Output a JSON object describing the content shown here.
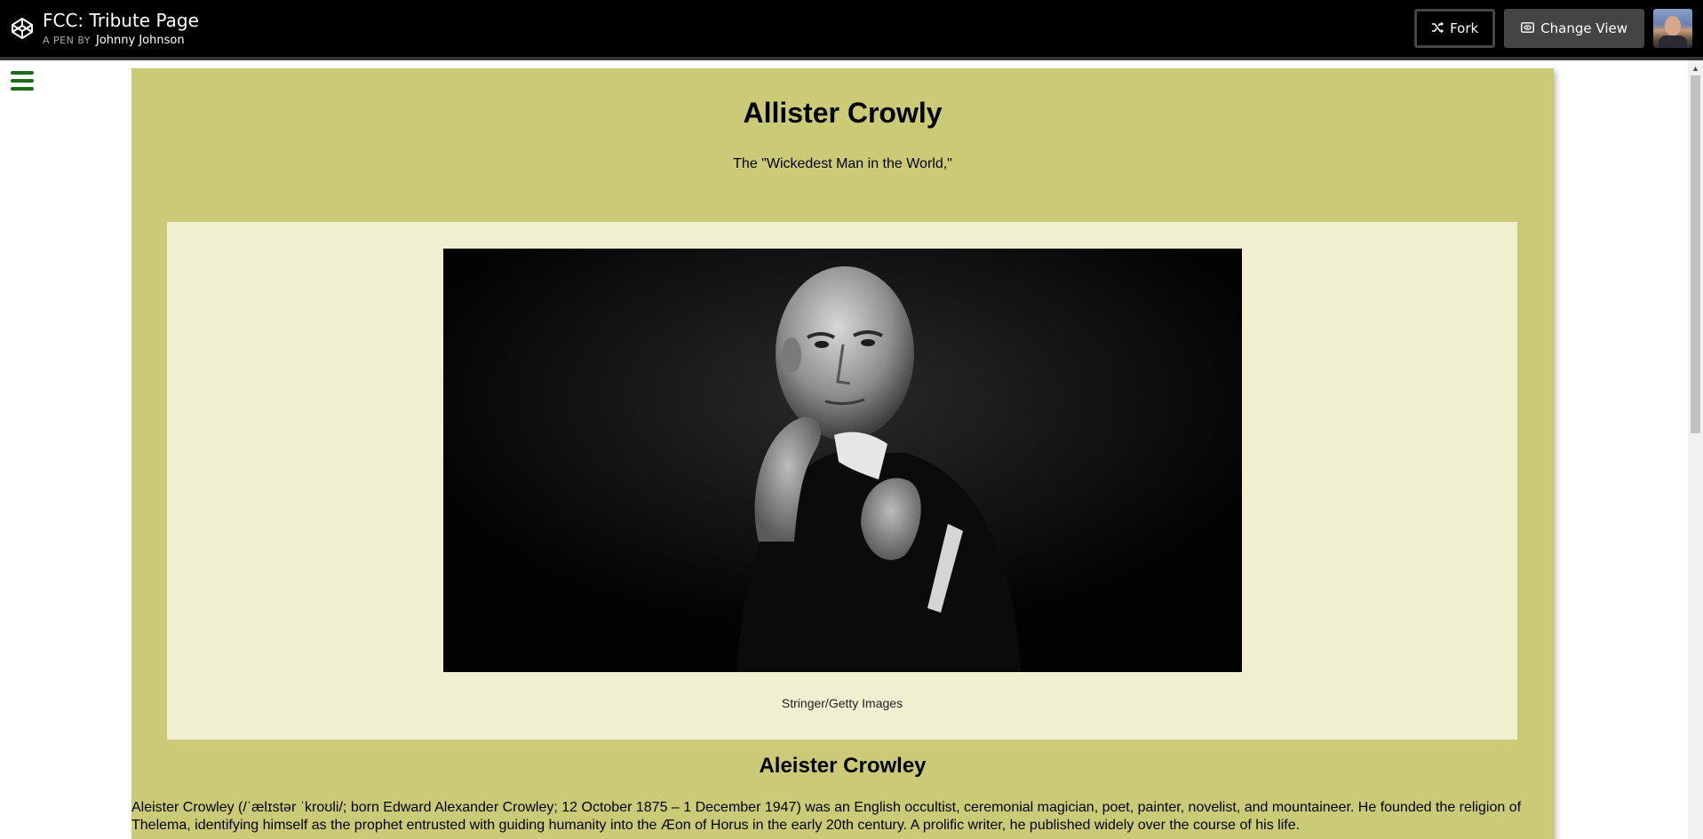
{
  "header": {
    "title": "FCC: Tribute Page",
    "by_label": "A PEN BY",
    "author": "Johnny Johnson",
    "fork_label": "Fork",
    "change_view_label": "Change View"
  },
  "colors": {
    "header_bg": "#000000",
    "main_bg": "#cbca77",
    "img_div_bg": "#f0efd0",
    "hamburger": "#1b6b1b"
  },
  "icons": [
    "codepen-logo-icon",
    "fork-icon",
    "eye-icon",
    "hamburger-menu-icon"
  ],
  "page": {
    "title": "Allister Crowly",
    "subtitle": "The \"Wickedest Man in the World,\"",
    "image_caption": "Stringer/Getty Images",
    "bio_title": "Aleister Crowley",
    "bio_text": "Aleister Crowley (/ˈælɪstər ˈkroʊli/; born Edward Alexander Crowley; 12 October 1875 – 1 December 1947) was an English occultist, ceremonial magician, poet, painter, novelist, and mountaineer. He founded the religion of Thelema, identifying himself as the prophet entrusted with guiding humanity into the Æon of Horus in the early 20th century. A prolific writer, he published widely over the course of his life."
  }
}
